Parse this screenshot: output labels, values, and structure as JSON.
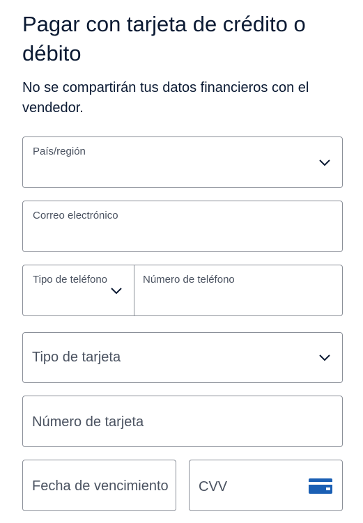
{
  "page": {
    "title": "Pagar con tarjeta de crédito o débito",
    "subtitle": "No se compartirán tus datos financieros con el vendedor."
  },
  "form": {
    "country_label": "País/región",
    "email_label": "Correo electrónico",
    "phone_type_label": "Tipo de teléfono",
    "phone_number_label": "Número de teléfono",
    "card_type_placeholder": "Tipo de tarjeta",
    "card_number_placeholder": "Número de tarjeta",
    "expiry_placeholder": "Fecha de vencimiento",
    "cvv_placeholder": "CVV"
  },
  "colors": {
    "text": "#0b1a33",
    "border": "#8a8f98",
    "card_icon": "#1a5fb4"
  },
  "icons": {
    "dropdown": "chevron-down-icon",
    "cvv_card": "credit-card-icon"
  }
}
